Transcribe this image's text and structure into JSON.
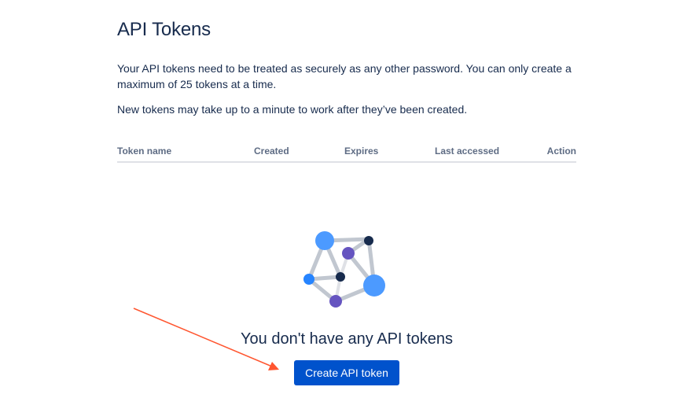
{
  "page": {
    "title": "API Tokens",
    "description_1": "Your API tokens need to be treated as securely as any other password. You can only create a maximum of 25 tokens at a time.",
    "description_2": "New tokens may take up to a minute to work after they’ve been created."
  },
  "table": {
    "columns": [
      "Token name",
      "Created",
      "Expires",
      "Last accessed",
      "Action"
    ]
  },
  "empty_state": {
    "title": "You don't have any API tokens",
    "illustration": "network-nodes-illustration"
  },
  "actions": {
    "create_label": "Create API token"
  },
  "colors": {
    "primary": "#0052cc",
    "text": "#172b4d",
    "subtle_text": "#5e6c84",
    "annotation": "#ff5630"
  }
}
